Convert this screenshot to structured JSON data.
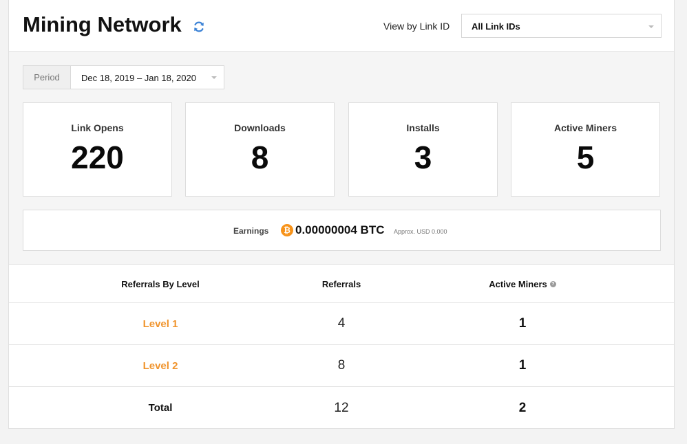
{
  "header": {
    "title": "Mining Network",
    "view_by_label": "View by Link ID",
    "link_id_selected": "All Link IDs"
  },
  "period": {
    "label": "Period",
    "value": "Dec 18, 2019 – Jan 18, 2020"
  },
  "stats": [
    {
      "label": "Link Opens",
      "value": "220"
    },
    {
      "label": "Downloads",
      "value": "8"
    },
    {
      "label": "Installs",
      "value": "3"
    },
    {
      "label": "Active Miners",
      "value": "5"
    }
  ],
  "earnings": {
    "label": "Earnings",
    "value": "0.00000004 BTC",
    "approx": "Approx. USD 0.000",
    "icon": "bitcoin-icon",
    "icon_color": "#f7931a"
  },
  "table": {
    "headers": [
      "Referrals By Level",
      "Referrals",
      "Active Miners"
    ],
    "rows": [
      {
        "level": "Level 1",
        "referrals": "4",
        "active": "1"
      },
      {
        "level": "Level 2",
        "referrals": "8",
        "active": "1"
      },
      {
        "level": "Total",
        "referrals": "12",
        "active": "2"
      }
    ]
  },
  "colors": {
    "accent_link": "#f0932b",
    "refresh_icon": "#3b82d6"
  }
}
